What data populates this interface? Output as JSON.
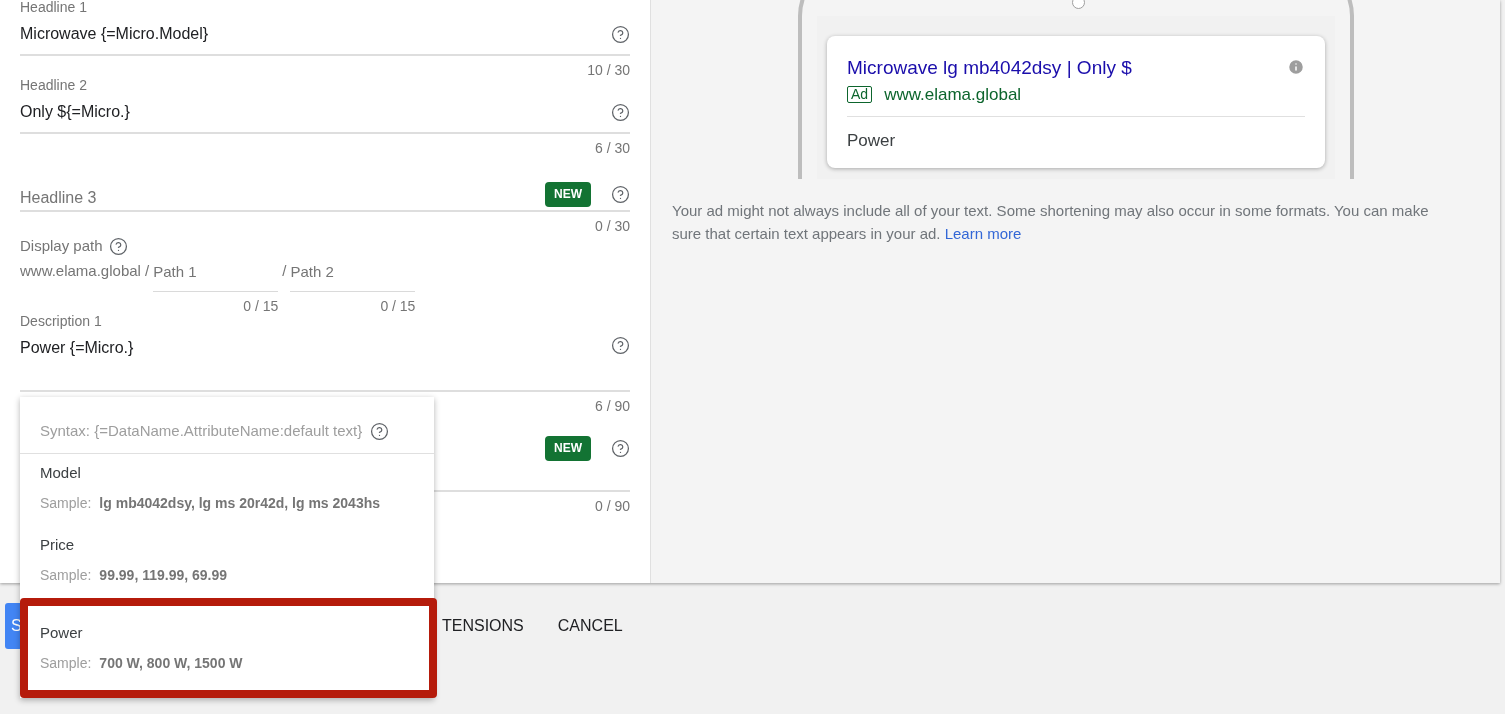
{
  "form": {
    "fields": [
      {
        "kind": "headline",
        "label": "Headline 1",
        "value": "Microwave {=Micro.Model}",
        "counter": "10 / 30"
      },
      {
        "kind": "headline",
        "label": "Headline 2",
        "value": "Only ${=Micro.}",
        "counter": "6 / 30"
      },
      {
        "kind": "headline",
        "placeholder": "Headline 3",
        "badge": "NEW",
        "counter": "0 / 30"
      },
      {
        "kind": "path",
        "label": "Display path",
        "domain": "www.elama.global /",
        "separator": "/",
        "paths": [
          {
            "placeholder": "Path 1",
            "counter": "0 / 15"
          },
          {
            "placeholder": "Path 2",
            "counter": "0 / 15"
          }
        ]
      },
      {
        "kind": "description",
        "label": "Description 1",
        "value": "Power {=Micro.}",
        "counter": "6 / 90"
      },
      {
        "kind": "description",
        "badge": "NEW",
        "counter": "0 / 90"
      }
    ]
  },
  "preview": {
    "title": "Microwave lg mb4042dsy | Only $",
    "ad_label": "Ad",
    "url": "www.elama.global",
    "description": "Power"
  },
  "note": {
    "text": "Your ad might not always include all of your text. Some shortening may also occur in some formats. You can make sure that certain text appears in your ad.",
    "link": "Learn more"
  },
  "footer": {
    "buttons": [
      {
        "label": "S",
        "kind": "primary"
      },
      {
        "label": "TENSIONS",
        "kind": "text"
      },
      {
        "label": "CANCEL",
        "kind": "text"
      }
    ]
  },
  "dropdown": {
    "syntax": "Syntax: {=DataName.AttributeName:default text}",
    "items": [
      {
        "name": "Model",
        "sample_label": "Sample:",
        "sample": "lg mb4042dsy, lg ms 20r42d, lg ms 2043hs",
        "selected": false
      },
      {
        "name": "Price",
        "sample_label": "Sample:",
        "sample": "99.99, 119.99, 69.99",
        "selected": false
      },
      {
        "name": "Power",
        "sample_label": "Sample:",
        "sample": "700 W, 800 W, 1500 W",
        "selected": true
      }
    ]
  }
}
